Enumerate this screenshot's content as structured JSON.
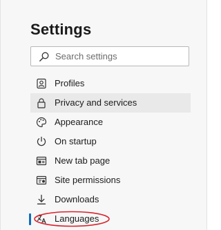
{
  "page": {
    "title": "Settings"
  },
  "search": {
    "placeholder": "Search settings",
    "icon": "search-icon"
  },
  "nav": {
    "items": [
      {
        "label": "Profiles",
        "icon": "profile-icon",
        "selected": false,
        "active": false
      },
      {
        "label": "Privacy and services",
        "icon": "lock-icon",
        "selected": true,
        "active": false
      },
      {
        "label": "Appearance",
        "icon": "palette-icon",
        "selected": false,
        "active": false
      },
      {
        "label": "On startup",
        "icon": "power-icon",
        "selected": false,
        "active": false
      },
      {
        "label": "New tab page",
        "icon": "new-tab-icon",
        "selected": false,
        "active": false
      },
      {
        "label": "Site permissions",
        "icon": "site-permissions-icon",
        "selected": false,
        "active": false
      },
      {
        "label": "Downloads",
        "icon": "download-icon",
        "selected": false,
        "active": false
      },
      {
        "label": "Languages",
        "icon": "languages-icon",
        "selected": false,
        "active": true
      }
    ]
  },
  "colors": {
    "accent": "#0f6cbd",
    "annotation": "#d9232d",
    "selected_bg": "#e9e9e9"
  }
}
